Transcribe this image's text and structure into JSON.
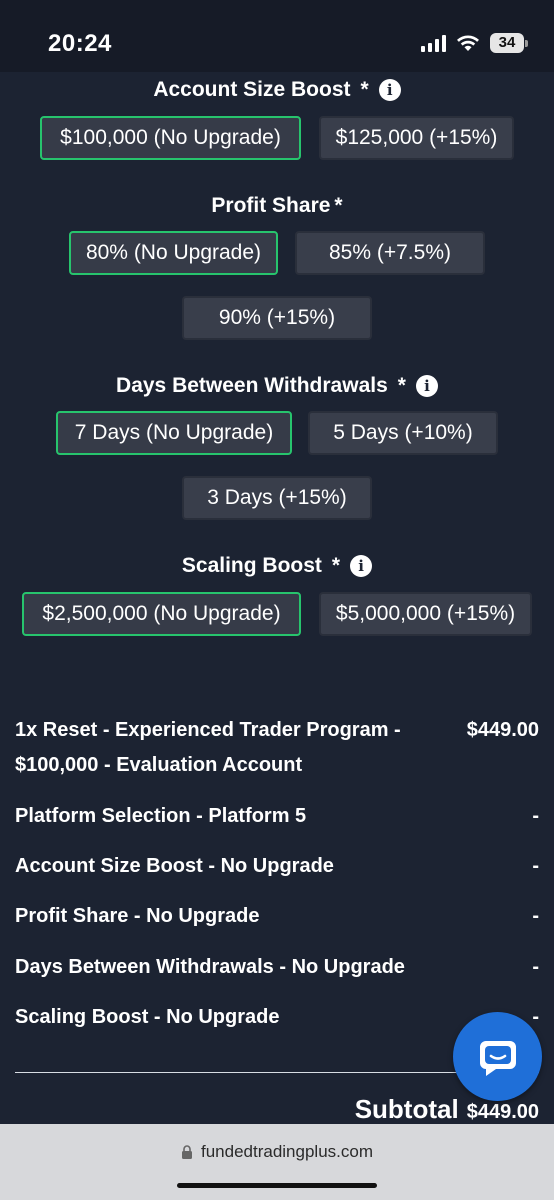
{
  "status": {
    "time": "20:24",
    "battery": "34"
  },
  "account_size": {
    "title": "Account Size Boost",
    "required": "*",
    "options": [
      "$100,000 (No Upgrade)",
      "$125,000 (+15%)"
    ]
  },
  "profit_share": {
    "title": "Profit Share",
    "required": "*",
    "options": [
      "80% (No Upgrade)",
      "85% (+7.5%)",
      "90% (+15%)"
    ]
  },
  "days_between": {
    "title": "Days Between Withdrawals",
    "required": "*",
    "options": [
      "7 Days (No Upgrade)",
      "5 Days (+10%)",
      "3 Days (+15%)"
    ]
  },
  "scaling": {
    "title": "Scaling Boost",
    "required": "*",
    "options": [
      "$2,500,000 (No Upgrade)",
      "$5,000,000 (+15%)"
    ]
  },
  "summary": {
    "rows": [
      {
        "label": "1x Reset - Experienced Trader Program - $100,000 - Evaluation Account",
        "price": "$449.00"
      },
      {
        "label": "Platform Selection - Platform 5",
        "price": "-"
      },
      {
        "label": "Account Size Boost - No Upgrade",
        "price": "-"
      },
      {
        "label": "Profit Share - No Upgrade",
        "price": "-"
      },
      {
        "label": "Days Between Withdrawals - No Upgrade",
        "price": "-"
      },
      {
        "label": "Scaling Boost - No Upgrade",
        "price": "-"
      }
    ],
    "subtotal_label": "Subtotal",
    "subtotal_value": "$449.00"
  },
  "browser": {
    "url": "fundedtradingplus.com"
  },
  "colors": {
    "background": "#1c2332",
    "selected_border": "#27c46d",
    "option_bg": "#393e4b",
    "chat": "#1f6fd8"
  },
  "icons": {
    "info": "info-icon",
    "chat": "chat-bubble-icon",
    "lock": "lock-icon"
  }
}
